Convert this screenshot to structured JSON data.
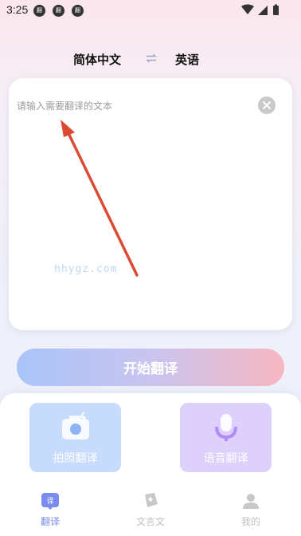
{
  "status_bar": {
    "time": "3:25",
    "notification_badges": [
      "翻",
      "翻",
      "翻"
    ]
  },
  "language_bar": {
    "source": "简体中文",
    "target": "英语"
  },
  "input": {
    "placeholder": "请输入需要翻译的文本",
    "value": ""
  },
  "watermark": "hhygz.com",
  "actions": {
    "translate_label": "开始翻译"
  },
  "features": [
    {
      "label": "拍照翻译",
      "icon": "camera-icon"
    },
    {
      "label": "语音翻译",
      "icon": "microphone-icon"
    }
  ],
  "tabs": [
    {
      "label": "翻译",
      "icon": "translate-icon",
      "active": true
    },
    {
      "label": "文言文",
      "icon": "scroll-icon",
      "active": false
    },
    {
      "label": "我的",
      "icon": "user-icon",
      "active": false
    }
  ],
  "colors": {
    "accent": "#7a8cf0",
    "annotation_arrow": "#dc4a34",
    "photo_card": "#c7dcfc",
    "voice_card": "#ddd0fb"
  }
}
